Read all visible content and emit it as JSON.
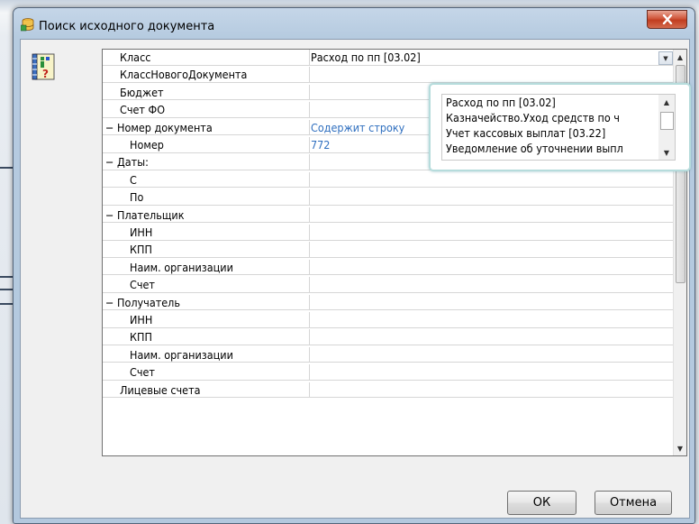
{
  "window": {
    "title": "Поиск исходного документа"
  },
  "grid": {
    "rows": [
      {
        "name": "Класс",
        "indent": 1,
        "value": "Расход по пп [03.02]",
        "link": false
      },
      {
        "name": "КлассНовогоДокумента",
        "indent": 1,
        "value": "",
        "link": false
      },
      {
        "name": "Бюджет",
        "indent": 1,
        "value": "",
        "link": false
      },
      {
        "name": "Счет ФО",
        "indent": 1,
        "value": "",
        "link": false
      },
      {
        "name": "− Номер документа",
        "indent": 0,
        "value": "Содержит строку",
        "link": true
      },
      {
        "name": "Номер",
        "indent": 2,
        "value": "772",
        "link": true
      },
      {
        "name": "− Даты:",
        "indent": 0,
        "value": "",
        "link": false
      },
      {
        "name": "С",
        "indent": 2,
        "value": "",
        "link": false
      },
      {
        "name": "По",
        "indent": 2,
        "value": "",
        "link": false
      },
      {
        "name": "− Плательщик",
        "indent": 0,
        "value": "",
        "link": false
      },
      {
        "name": "ИНН",
        "indent": 2,
        "value": "",
        "link": false
      },
      {
        "name": "КПП",
        "indent": 2,
        "value": "",
        "link": false
      },
      {
        "name": "Наим. организации",
        "indent": 2,
        "value": "",
        "link": false
      },
      {
        "name": "Счет",
        "indent": 2,
        "value": "",
        "link": false
      },
      {
        "name": "− Получатель",
        "indent": 0,
        "value": "",
        "link": false
      },
      {
        "name": "ИНН",
        "indent": 2,
        "value": "",
        "link": false
      },
      {
        "name": "КПП",
        "indent": 2,
        "value": "",
        "link": false
      },
      {
        "name": "Наим. организации",
        "indent": 2,
        "value": "",
        "link": false
      },
      {
        "name": "Счет",
        "indent": 2,
        "value": "",
        "link": false
      },
      {
        "name": "Лицевые счета",
        "indent": 1,
        "value": "",
        "link": false
      }
    ]
  },
  "dropdown": {
    "options": [
      "Расход по пп [03.02]",
      "Казначейство.Уход средств по ч",
      "Учет кассовых выплат [03.22]",
      "Уведомление об уточнении выпл"
    ]
  },
  "buttons": {
    "ok": "ОК",
    "cancel": "Отмена"
  },
  "colors": {
    "link": "#2f6fbf",
    "close": "#c13d20",
    "popup_border": "#b6dcdc"
  }
}
